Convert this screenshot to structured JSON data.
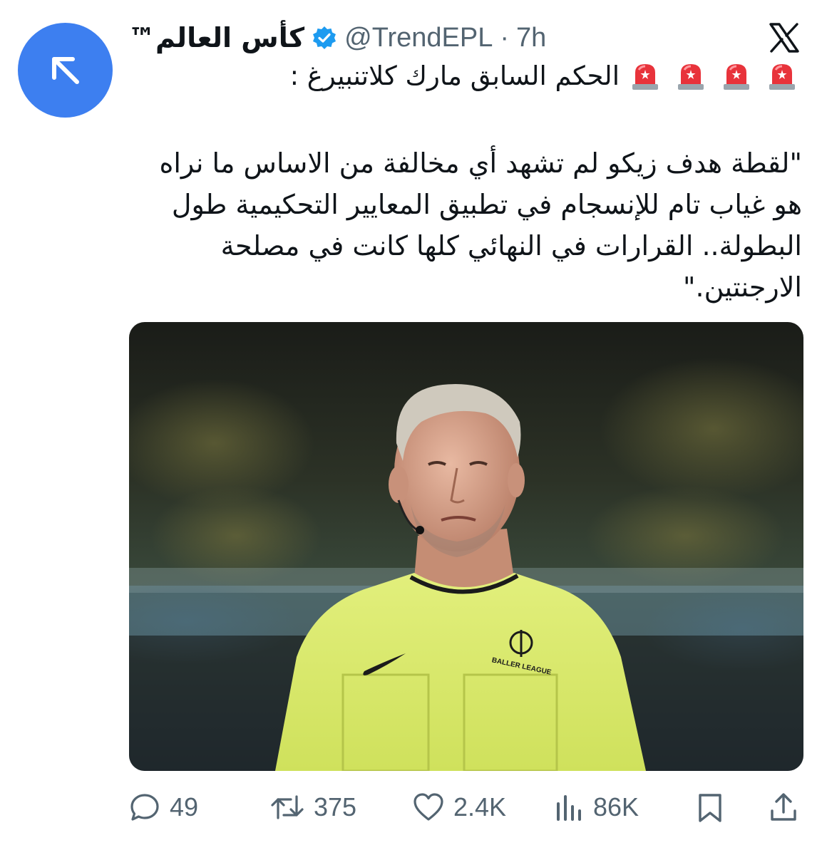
{
  "tweet": {
    "display_name": "كأس العالم™",
    "handle": "@TrendEPL",
    "separator": "·",
    "time": "7h",
    "title_line": "الحكم السابق مارك كلاتنبيرغ :",
    "body": "\"لقطة هدف زيكو لم تشهد أي مخالفة من الاساس ما نراه\nهو غياب تام للإنسجام في تطبيق المعايير التحكيمية طول\nالبطولة.. القرارات في النهائي كلها كانت في مصلحة\nالارجنتين.\"",
    "emoji_count": 4,
    "shirt_logo_text": "BALLER LEAGUE"
  },
  "actions": {
    "replies": "49",
    "reposts": "375",
    "likes": "2.4K",
    "views": "86K"
  },
  "colors": {
    "avatar": "#3d7ff0",
    "verified": "#1d9bf0",
    "muted": "#536471",
    "text": "#0f1419",
    "shirt": "#d9ec6a"
  },
  "icons": [
    "arrow-up-left-icon",
    "verified-badge-icon",
    "x-logo-icon",
    "siren-icon",
    "reply-icon",
    "repost-icon",
    "like-icon",
    "views-icon",
    "bookmark-icon",
    "share-icon"
  ]
}
